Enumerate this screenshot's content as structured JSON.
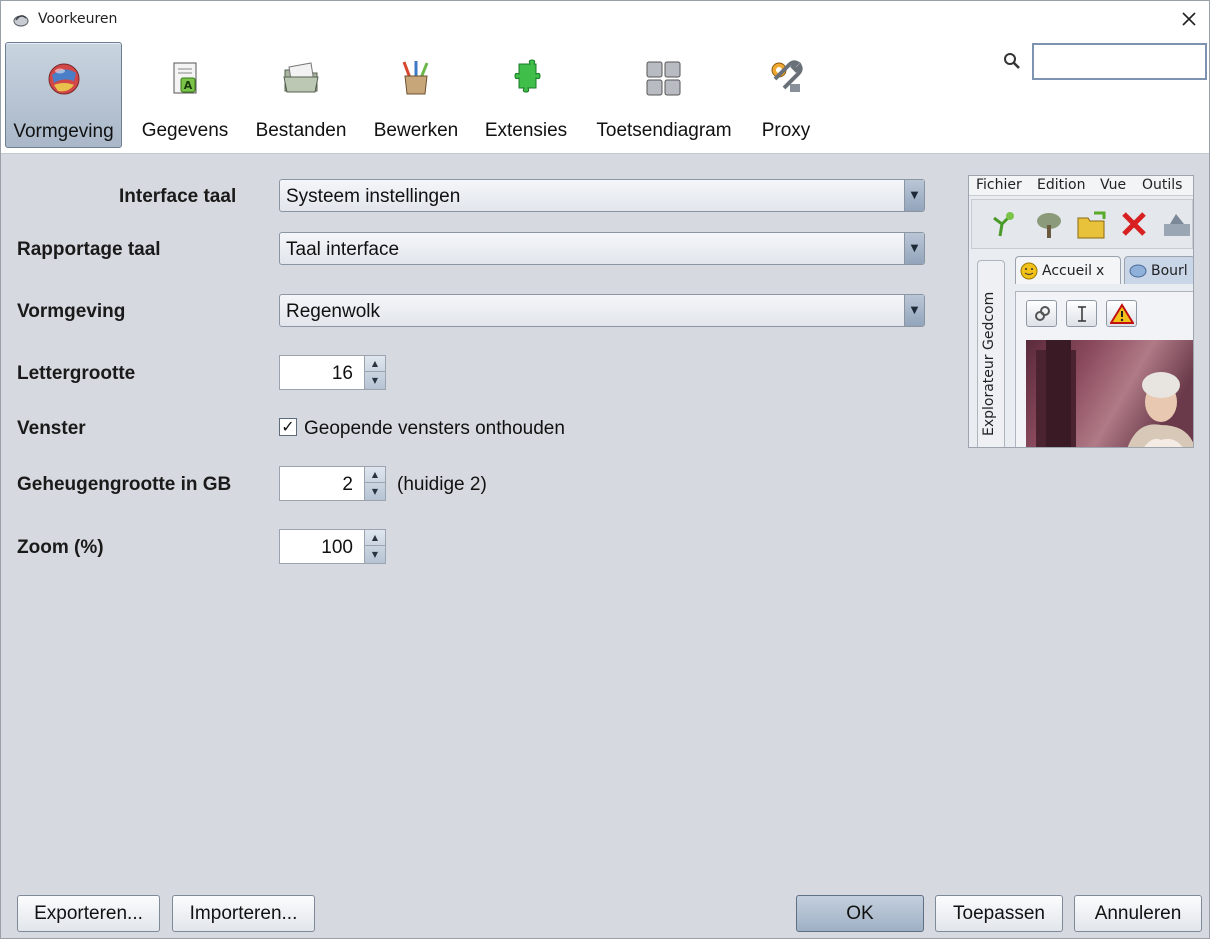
{
  "window": {
    "title": "Voorkeuren"
  },
  "toolbar": {
    "items": [
      {
        "label": "Vormgeving",
        "icon": "globe-icon",
        "selected": true
      },
      {
        "label": "Gegevens",
        "icon": "document-icon",
        "selected": false
      },
      {
        "label": "Bestanden",
        "icon": "folder-icon",
        "selected": false
      },
      {
        "label": "Bewerken",
        "icon": "pencil-cup-icon",
        "selected": false
      },
      {
        "label": "Extensies",
        "icon": "puzzle-icon",
        "selected": false
      },
      {
        "label": "Toetsendiagram",
        "icon": "keyboard-icon",
        "selected": false
      },
      {
        "label": "Proxy",
        "icon": "wrench-gear-icon",
        "selected": false
      }
    ],
    "search": {
      "value": "",
      "icon": "search-icon"
    }
  },
  "form": {
    "interface_language": {
      "label": "Interface taal",
      "value": "Systeem instellingen"
    },
    "report_language": {
      "label": "Rapportage taal",
      "value": "Taal interface"
    },
    "look_and_feel": {
      "label": "Vormgeving",
      "value": "Regenwolk"
    },
    "font_size": {
      "label": "Lettergrootte",
      "value": "16"
    },
    "window": {
      "label": "Venster",
      "checkbox_label": "Geopende vensters onthouden",
      "checked": true
    },
    "memory": {
      "label": "Geheugengrootte in GB",
      "value": "2",
      "note": "(huidige 2)"
    },
    "zoom": {
      "label": "Zoom (%)",
      "value": "100"
    }
  },
  "preview": {
    "menu": [
      "Fichier",
      "Edition",
      "Vue",
      "Outils"
    ],
    "side_tab": "Explorateur Gedcom",
    "tabs": [
      {
        "label": "Accueil",
        "close": "x"
      },
      {
        "label": "Bourl"
      }
    ]
  },
  "buttons": {
    "export": "Exporteren...",
    "import": "Importeren...",
    "ok": "OK",
    "apply": "Toepassen",
    "cancel": "Annuleren"
  }
}
